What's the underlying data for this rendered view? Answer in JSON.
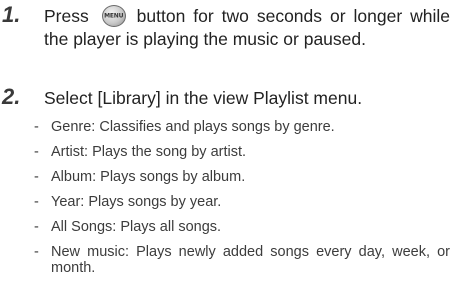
{
  "steps": [
    {
      "number": "1.",
      "text_before_icon": "Press",
      "icon_label": "MENU",
      "text_after_icon": "button for two seconds or longer while the player is playing the music or paused."
    },
    {
      "number": "2.",
      "text": "Select [Library] in the view Playlist menu."
    }
  ],
  "bullets": [
    {
      "dash": "-",
      "text": "Genre: Classifies and plays songs by genre."
    },
    {
      "dash": "-",
      "text": "Artist: Plays the song by artist."
    },
    {
      "dash": "-",
      "text": "Album: Plays songs by album."
    },
    {
      "dash": "-",
      "text": "Year: Plays songs by year."
    },
    {
      "dash": "-",
      "text": "All Songs: Plays all songs."
    },
    {
      "dash": "-",
      "text": "New music: Plays newly added songs every day, week, or month."
    }
  ]
}
